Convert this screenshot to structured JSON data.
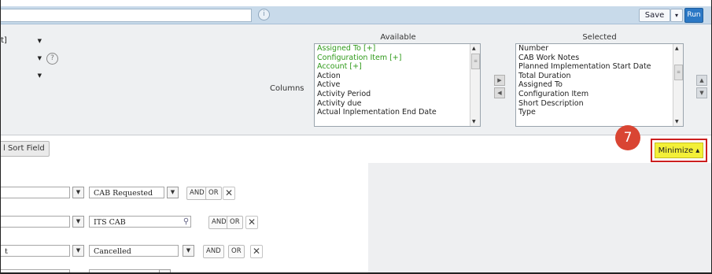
{
  "header": {
    "info_icon": "info-icon",
    "save_label": "Save",
    "save_arrow": "▾",
    "run_label": "Run"
  },
  "config": {
    "select1": "t]",
    "help_icon": "?",
    "columns_label": "Columns",
    "available_title": "Available",
    "selected_title": "Selected",
    "available_items": [
      {
        "label": "Assigned To [+]",
        "color": "#2f9a1a"
      },
      {
        "label": "Configuration Item [+]",
        "color": "#2f9a1a"
      },
      {
        "label": "Account [+]",
        "color": "#2f9a1a"
      },
      {
        "label": "Action",
        "color": "#222222"
      },
      {
        "label": "Active",
        "color": "#222222"
      },
      {
        "label": "Activity Period",
        "color": "#222222"
      },
      {
        "label": "Activity due",
        "color": "#222222"
      },
      {
        "label": "Actual Inplementation End Date",
        "color": "#222222"
      }
    ],
    "selected_items": [
      "Number",
      "CAB Work Notes",
      "Planned Implementation Start Date",
      "Total Duration",
      "Assigned To",
      "Configuration Item",
      "Short Description",
      "Type"
    ]
  },
  "sort": {
    "label": "l Sort Field"
  },
  "annotation": {
    "badge": "7",
    "minimize_label": "Minimize ▴"
  },
  "filters": {
    "rows": [
      {
        "field": "",
        "value": "CAB Requested",
        "and": "AND",
        "or": "OR",
        "x": "✕"
      },
      {
        "field": "",
        "value": "ITS CAB",
        "and": "AND",
        "or": "OR",
        "x": "✕"
      },
      {
        "field": "t",
        "value": "Cancelled",
        "and": "AND",
        "or": "OR",
        "x": "✕"
      }
    ]
  }
}
